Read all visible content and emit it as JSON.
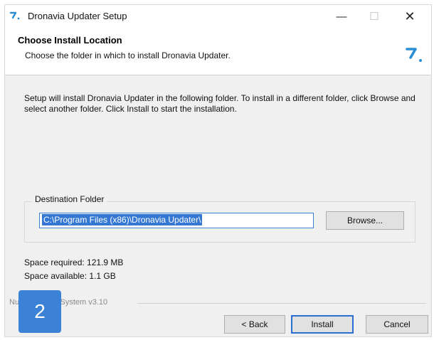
{
  "window": {
    "title": "Dronavia Updater Setup",
    "minimize_glyph": "—",
    "maximize_glyph": "☐",
    "close_glyph": "✕"
  },
  "header": {
    "title": "Choose Install Location",
    "subtitle": "Choose the folder in which to install Dronavia Updater."
  },
  "body": {
    "intro": "Setup will install Dronavia Updater in the following folder. To install in a different folder, click Browse and select another folder. Click Install to start the installation.",
    "destination_label": "Destination Folder",
    "destination_path": "C:\\Program Files (x86)\\Dronavia Updater\\",
    "browse_label": "Browse...",
    "space_required": "Space required: 121.9 MB",
    "space_available": "Space available: 1.1 GB"
  },
  "footer": {
    "branding": "Nullsoft Install System v3.10",
    "back_label": "< Back",
    "install_label": "Install",
    "cancel_label": "Cancel"
  },
  "overlay": {
    "step_badge": "2"
  },
  "icons": {
    "app": "dronavia-logo-icon"
  },
  "colors": {
    "accent": "#2b8fd6",
    "selection": "#3478d4",
    "badge": "#3b82d6"
  }
}
